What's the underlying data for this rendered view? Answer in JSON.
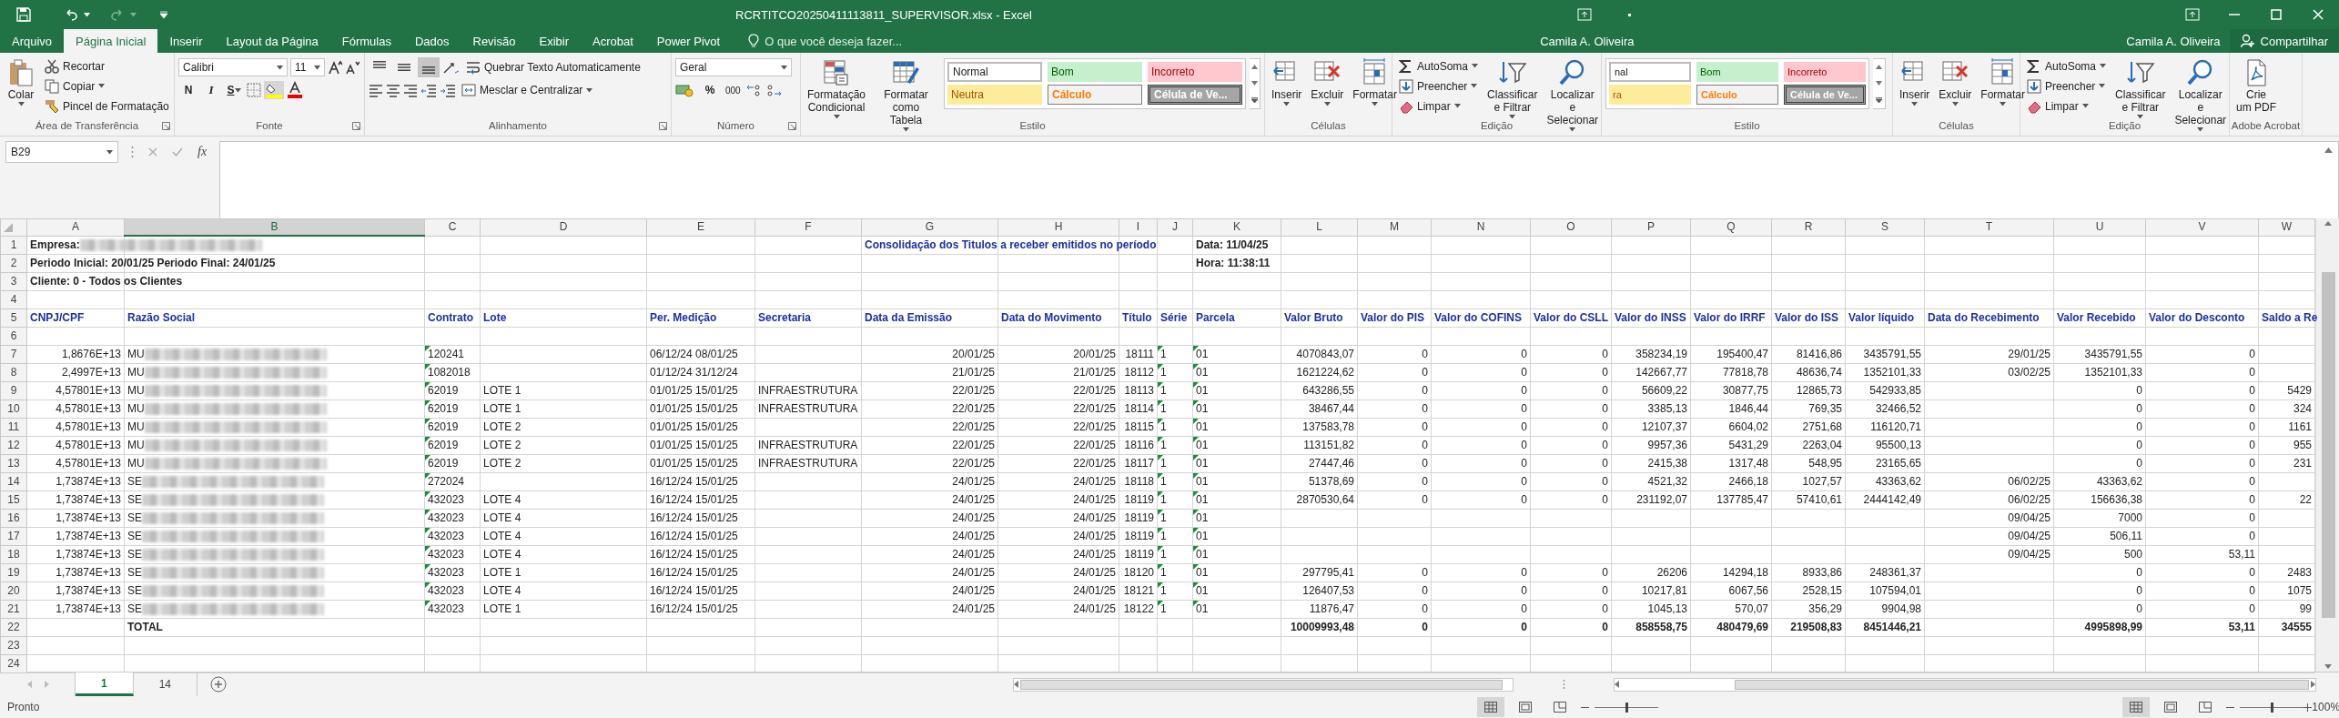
{
  "title_bar": {
    "title": "RCRTITCO20250411113811_SUPERVISOR.xlsx - Excel"
  },
  "ribbon_tabs": {
    "tabs": [
      {
        "label": "Arquivo",
        "selected": false
      },
      {
        "label": "Página Inicial",
        "selected": true
      },
      {
        "label": "Inserir",
        "selected": false
      },
      {
        "label": "Layout da Página",
        "selected": false
      },
      {
        "label": "Fórmulas",
        "selected": false
      },
      {
        "label": "Dados",
        "selected": false
      },
      {
        "label": "Revisão",
        "selected": false
      },
      {
        "label": "Exibir",
        "selected": false
      },
      {
        "label": "Acrobat",
        "selected": false
      },
      {
        "label": "Power Pivot",
        "selected": false
      }
    ],
    "search": {
      "placeholder": "O que você deseja fazer..."
    },
    "users": [
      "Camila A. Oliveira",
      "Camila A. Oliveira"
    ],
    "share": "Compartilhar"
  },
  "ribbon": {
    "groups": [
      {
        "kind": "clipboard",
        "label": "Área de Transferência",
        "items": [
          {
            "kind": "paste",
            "lines": [
              "Colar"
            ]
          },
          {
            "kind": "cut",
            "label": "Recortar"
          },
          {
            "kind": "copy",
            "label": "Copiar"
          },
          {
            "kind": "brush",
            "label": "Pincel de Formatação"
          }
        ]
      },
      {
        "kind": "font",
        "label": "Fonte",
        "items": [
          {
            "kind": "font",
            "label": "Calibri"
          },
          {
            "kind": "size",
            "label": "11"
          },
          {
            "kind": "bold",
            "label": "N"
          },
          {
            "kind": "italic",
            "label": "I"
          },
          {
            "kind": "underline",
            "label": "S"
          }
        ]
      },
      {
        "kind": "alignment",
        "label": "Alinhamento",
        "items": [
          {
            "kind": "align_top",
            "selected": false
          },
          {
            "kind": "align_middle",
            "selected": false
          },
          {
            "kind": "align_bottom",
            "selected": true
          },
          {
            "kind": "wrap",
            "label": "Quebrar Texto Automaticamente"
          },
          {
            "kind": "merge",
            "label": "Mesclar e Centralizar"
          }
        ]
      },
      {
        "kind": "number",
        "label": "Número",
        "items": [
          {
            "kind": "format",
            "label": "Geral"
          },
          {
            "kind": "percent",
            "label": "%"
          },
          {
            "kind": "thousands",
            "label": "000"
          }
        ]
      },
      {
        "kind": "styles",
        "label": "Estilo",
        "buttons": [
          {
            "kind": "condformat",
            "lines": [
              "Formatação",
              "Condicional"
            ]
          },
          {
            "kind": "table",
            "lines": [
              "Formatar como",
              "Tabela"
            ]
          }
        ],
        "items": [
          {
            "kind": "normal",
            "label": "Normal"
          },
          {
            "kind": "good",
            "label": "Bom"
          },
          {
            "kind": "bad",
            "label": "Incorreto"
          },
          {
            "kind": "neutral",
            "label": "Neutra"
          },
          {
            "kind": "calc",
            "label": "Cálculo"
          },
          {
            "kind": "check",
            "label": "Célula de Ve..."
          }
        ]
      },
      {
        "kind": "cells",
        "label": "Células",
        "items": [
          {
            "kind": "insert",
            "lines": [
              "Inserir"
            ]
          },
          {
            "kind": "delete",
            "lines": [
              "Excluir"
            ]
          },
          {
            "kind": "format",
            "lines": [
              "Formatar"
            ]
          }
        ]
      },
      {
        "kind": "editing",
        "label": "Edição",
        "items": [
          {
            "kind": "sum",
            "label": "AutoSoma"
          },
          {
            "kind": "fill",
            "label": "Preencher"
          },
          {
            "kind": "clear",
            "label": "Limpar"
          },
          {
            "kind": "sort",
            "lines": [
              "Classificar",
              "e Filtrar"
            ]
          },
          {
            "kind": "find",
            "lines": [
              "Localizar e",
              "Selecionar"
            ]
          }
        ]
      },
      {
        "kind": "styles",
        "label": "Estilo",
        "items": [
          {
            "kind": "normal",
            "label": "nal"
          },
          {
            "kind": "good",
            "label": "Bom"
          },
          {
            "kind": "bad",
            "label": "Incorreto"
          },
          {
            "kind": "neutral",
            "label": "ra"
          },
          {
            "kind": "calc",
            "label": "Cálculo"
          },
          {
            "kind": "check",
            "label": "Célula de Ve..."
          }
        ]
      },
      {
        "kind": "cells",
        "label": "Células",
        "items": [
          {
            "kind": "insert",
            "lines": [
              "Inserir"
            ]
          },
          {
            "kind": "delete",
            "lines": [
              "Excluir"
            ]
          },
          {
            "kind": "format",
            "lines": [
              "Formatar"
            ]
          }
        ]
      },
      {
        "kind": "editing",
        "label": "Edição",
        "items": [
          {
            "kind": "sum",
            "label": "AutoSoma"
          },
          {
            "kind": "fill",
            "label": "Preencher"
          },
          {
            "kind": "clear",
            "label": "Limpar"
          },
          {
            "kind": "sort",
            "lines": [
              "Classificar",
              "e Filtrar"
            ]
          },
          {
            "kind": "find",
            "lines": [
              "Localizar e",
              "Selecionar"
            ]
          }
        ]
      },
      {
        "kind": "acrobat",
        "label": "Adobe Acrobat",
        "items": [
          {
            "kind": "pdf",
            "lines": [
              "Crie",
              "um PDF"
            ]
          }
        ]
      }
    ]
  },
  "formula_bar": {
    "name_box": "B29",
    "function_label": "fx"
  },
  "sheet": {
    "columns": [
      {
        "letter": "A",
        "selected": false
      },
      {
        "letter": "B",
        "selected": true
      },
      {
        "letter": "C",
        "selected": false
      },
      {
        "letter": "D",
        "selected": false
      },
      {
        "letter": "E",
        "selected": false
      },
      {
        "letter": "F",
        "selected": false
      },
      {
        "letter": "G",
        "selected": false
      },
      {
        "letter": "H",
        "selected": false
      },
      {
        "letter": "I",
        "selected": false
      },
      {
        "letter": "J",
        "selected": false
      },
      {
        "letter": "K",
        "selected": false
      },
      {
        "letter": "L",
        "selected": false
      },
      {
        "letter": "M",
        "selected": false
      },
      {
        "letter": "N",
        "selected": false
      },
      {
        "letter": "O",
        "selected": false
      },
      {
        "letter": "P",
        "selected": false
      },
      {
        "letter": "Q",
        "selected": false
      },
      {
        "letter": "R",
        "selected": false
      },
      {
        "letter": "S",
        "selected": false
      },
      {
        "letter": "T",
        "selected": false
      },
      {
        "letter": "U",
        "selected": false
      },
      {
        "letter": "V",
        "selected": false
      },
      {
        "letter": "W",
        "selected": false
      }
    ],
    "rows": [
      {
        "number": "1",
        "kind": "title",
        "cells": {
          "A": {
            "text": "Empresa:",
            "redacted": true
          },
          "G": {
            "text": "Consolidação dos Titulos a receber emitidos no período",
            "color": "#1f2fa0"
          },
          "K": "Data: 11/04/25"
        }
      },
      {
        "number": "2",
        "kind": "title",
        "cells": {
          "A": "Periodo Inicial: 20/01/25 Periodo Final: 24/01/25",
          "K": "Hora: 11:38:11"
        }
      },
      {
        "number": "3",
        "kind": "title",
        "cells": {
          "A": "Cliente: 0 - Todos os Clientes"
        }
      },
      {
        "number": "4",
        "kind": "blank",
        "cells": {}
      },
      {
        "number": "5",
        "kind": "header",
        "cells": {
          "A": "CNPJ/CPF",
          "B": "Razão Social",
          "C": "Contrato",
          "D": "Lote",
          "E": "Per. Medição",
          "F": "Secretaria",
          "G": "Data da Emissão",
          "H": "Data do Movimento",
          "I": "Título",
          "J": "Série",
          "K": "Parcela",
          "L": "Valor Bruto",
          "M": "Valor do PIS",
          "N": "Valor do COFINS",
          "O": "Valor do CSLL",
          "P": "Valor do INSS",
          "Q": "Valor do IRRF",
          "R": "Valor do ISS",
          "S": "Valor líquido",
          "T": "Data do Recebimento",
          "U": "Valor Recebido",
          "V": "Valor do Desconto",
          "W": "Saldo a Re"
        }
      },
      {
        "number": "6",
        "kind": "blank",
        "cells": {}
      },
      {
        "number": "7",
        "kind": "data",
        "cells": {
          "A": "1,8676E+13",
          "B": {
            "text": "MU",
            "redacted": true
          },
          "C": {
            "text": "120241",
            "flagged": true
          },
          "E": "06/12/24 08/01/25",
          "G": "20/01/25",
          "H": "20/01/25",
          "I": "18111",
          "J": {
            "text": "1",
            "flagged": true
          },
          "K": {
            "text": "01",
            "flagged": true
          },
          "L": "4070843,07",
          "M": "0",
          "N": "0",
          "O": "0",
          "P": "358234,19",
          "Q": "195400,47",
          "R": "81416,86",
          "S": "3435791,55",
          "T": "29/01/25",
          "U": "3435791,55",
          "V": "0"
        }
      },
      {
        "number": "8",
        "kind": "data",
        "cells": {
          "A": "2,4997E+13",
          "B": {
            "text": "MU",
            "redacted": true
          },
          "C": {
            "text": "1082018",
            "flagged": true
          },
          "E": "01/12/24 31/12/24",
          "G": "21/01/25",
          "H": "21/01/25",
          "I": "18112",
          "J": {
            "text": "1",
            "flagged": true
          },
          "K": {
            "text": "01",
            "flagged": true
          },
          "L": "1621224,62",
          "M": "0",
          "N": "0",
          "O": "0",
          "P": "142667,77",
          "Q": "77818,78",
          "R": "48636,74",
          "S": "1352101,33",
          "T": "03/02/25",
          "U": "1352101,33",
          "V": "0"
        }
      },
      {
        "number": "9",
        "kind": "data",
        "cells": {
          "A": "4,57801E+13",
          "B": {
            "text": "MU",
            "redacted": true
          },
          "C": {
            "text": "62019",
            "flagged": true
          },
          "D": "LOTE 1",
          "E": "01/01/25 15/01/25",
          "F": "INFRAESTRUTURA",
          "G": "22/01/25",
          "H": "22/01/25",
          "I": "18113",
          "J": {
            "text": "1",
            "flagged": true
          },
          "K": {
            "text": "01",
            "flagged": true
          },
          "L": "643286,55",
          "M": "0",
          "N": "0",
          "O": "0",
          "P": "56609,22",
          "Q": "30877,75",
          "R": "12865,73",
          "S": "542933,85",
          "U": "0",
          "V": "0",
          "W": "5429"
        }
      },
      {
        "number": "10",
        "kind": "data",
        "cells": {
          "A": "4,57801E+13",
          "B": {
            "text": "MU",
            "redacted": true
          },
          "C": {
            "text": "62019",
            "flagged": true
          },
          "D": "LOTE 1",
          "E": "01/01/25 15/01/25",
          "F": "INFRAESTRUTURA",
          "G": "22/01/25",
          "H": "22/01/25",
          "I": "18114",
          "J": {
            "text": "1",
            "flagged": true
          },
          "K": {
            "text": "01",
            "flagged": true
          },
          "L": "38467,44",
          "M": "0",
          "N": "0",
          "O": "0",
          "P": "3385,13",
          "Q": "1846,44",
          "R": "769,35",
          "S": "32466,52",
          "U": "0",
          "V": "0",
          "W": "324"
        }
      },
      {
        "number": "11",
        "kind": "data",
        "cells": {
          "A": "4,57801E+13",
          "B": {
            "text": "MU",
            "redacted": true
          },
          "C": {
            "text": "62019",
            "flagged": true
          },
          "D": "LOTE 2",
          "E": "01/01/25 15/01/25",
          "G": "22/01/25",
          "H": "22/01/25",
          "I": "18115",
          "J": {
            "text": "1",
            "flagged": true
          },
          "K": {
            "text": "01",
            "flagged": true
          },
          "L": "137583,78",
          "M": "0",
          "N": "0",
          "O": "0",
          "P": "12107,37",
          "Q": "6604,02",
          "R": "2751,68",
          "S": "116120,71",
          "U": "0",
          "V": "0",
          "W": "1161"
        }
      },
      {
        "number": "12",
        "kind": "data",
        "cells": {
          "A": "4,57801E+13",
          "B": {
            "text": "MU",
            "redacted": true
          },
          "C": {
            "text": "62019",
            "flagged": true
          },
          "D": "LOTE 2",
          "E": "01/01/25 15/01/25",
          "F": "INFRAESTRUTURA",
          "G": "22/01/25",
          "H": "22/01/25",
          "I": "18116",
          "J": {
            "text": "1",
            "flagged": true
          },
          "K": {
            "text": "01",
            "flagged": true
          },
          "L": "113151,82",
          "M": "0",
          "N": "0",
          "O": "0",
          "P": "9957,36",
          "Q": "5431,29",
          "R": "2263,04",
          "S": "95500,13",
          "U": "0",
          "V": "0",
          "W": "955"
        }
      },
      {
        "number": "13",
        "kind": "data",
        "cells": {
          "A": "4,57801E+13",
          "B": {
            "text": "MU",
            "redacted": true
          },
          "C": {
            "text": "62019",
            "flagged": true
          },
          "D": "LOTE 2",
          "E": "01/01/25 15/01/25",
          "F": "INFRAESTRUTURA",
          "G": "22/01/25",
          "H": "22/01/25",
          "I": "18117",
          "J": {
            "text": "1",
            "flagged": true
          },
          "K": {
            "text": "01",
            "flagged": true
          },
          "L": "27447,46",
          "M": "0",
          "N": "0",
          "O": "0",
          "P": "2415,38",
          "Q": "1317,48",
          "R": "548,95",
          "S": "23165,65",
          "U": "0",
          "V": "0",
          "W": "231"
        }
      },
      {
        "number": "14",
        "kind": "data",
        "cells": {
          "A": "1,73874E+13",
          "B": {
            "text": "SE",
            "redacted": true
          },
          "C": {
            "text": "272024",
            "flagged": true
          },
          "E": "16/12/24 15/01/25",
          "G": "24/01/25",
          "H": "24/01/25",
          "I": "18118",
          "J": {
            "text": "1",
            "flagged": true
          },
          "K": {
            "text": "01",
            "flagged": true
          },
          "L": "51378,69",
          "M": "0",
          "N": "0",
          "O": "0",
          "P": "4521,32",
          "Q": "2466,18",
          "R": "1027,57",
          "S": "43363,62",
          "T": "06/02/25",
          "U": "43363,62",
          "V": "0"
        }
      },
      {
        "number": "15",
        "kind": "data",
        "cells": {
          "A": "1,73874E+13",
          "B": {
            "text": "SE",
            "redacted": true
          },
          "C": {
            "text": "432023",
            "flagged": true
          },
          "D": "LOTE 4",
          "E": "16/12/24 15/01/25",
          "G": "24/01/25",
          "H": "24/01/25",
          "I": "18119",
          "J": {
            "text": "1",
            "flagged": true
          },
          "K": {
            "text": "01",
            "flagged": true
          },
          "L": "2870530,64",
          "M": "0",
          "N": "0",
          "O": "0",
          "P": "231192,07",
          "Q": "137785,47",
          "R": "57410,61",
          "S": "2444142,49",
          "T": "06/02/25",
          "U": "156636,38",
          "V": "0",
          "W": "22"
        }
      },
      {
        "number": "16",
        "kind": "data",
        "cells": {
          "A": "1,73874E+13",
          "B": {
            "text": "SE",
            "redacted": true
          },
          "C": {
            "text": "432023",
            "flagged": true
          },
          "D": "LOTE 4",
          "E": "16/12/24 15/01/25",
          "G": "24/01/25",
          "H": "24/01/25",
          "I": "18119",
          "J": {
            "text": "1",
            "flagged": true
          },
          "K": {
            "text": "01",
            "flagged": true
          },
          "T": "09/04/25",
          "U": "7000",
          "V": "0"
        }
      },
      {
        "number": "17",
        "kind": "data",
        "cells": {
          "A": "1,73874E+13",
          "B": {
            "text": "SE",
            "redacted": true
          },
          "C": {
            "text": "432023",
            "flagged": true
          },
          "D": "LOTE 4",
          "E": "16/12/24 15/01/25",
          "G": "24/01/25",
          "H": "24/01/25",
          "I": "18119",
          "J": {
            "text": "1",
            "flagged": true
          },
          "K": {
            "text": "01",
            "flagged": true
          },
          "T": "09/04/25",
          "U": "506,11",
          "V": "0"
        }
      },
      {
        "number": "18",
        "kind": "data",
        "cells": {
          "A": "1,73874E+13",
          "B": {
            "text": "SE",
            "redacted": true
          },
          "C": {
            "text": "432023",
            "flagged": true
          },
          "D": "LOTE 4",
          "E": "16/12/24 15/01/25",
          "G": "24/01/25",
          "H": "24/01/25",
          "I": "18119",
          "J": {
            "text": "1",
            "flagged": true
          },
          "K": {
            "text": "01",
            "flagged": true
          },
          "T": "09/04/25",
          "U": "500",
          "V": "53,11"
        }
      },
      {
        "number": "19",
        "kind": "data",
        "cells": {
          "A": "1,73874E+13",
          "B": {
            "text": "SE",
            "redacted": true
          },
          "C": {
            "text": "432023",
            "flagged": true
          },
          "D": "LOTE 1",
          "E": "16/12/24 15/01/25",
          "G": "24/01/25",
          "H": "24/01/25",
          "I": "18120",
          "J": {
            "text": "1",
            "flagged": true
          },
          "K": {
            "text": "01",
            "flagged": true
          },
          "L": "297795,41",
          "M": "0",
          "N": "0",
          "O": "0",
          "P": "26206",
          "Q": "14294,18",
          "R": "8933,86",
          "S": "248361,37",
          "U": "0",
          "V": "0",
          "W": "2483"
        }
      },
      {
        "number": "20",
        "kind": "data",
        "cells": {
          "A": "1,73874E+13",
          "B": {
            "text": "SE",
            "redacted": true
          },
          "C": {
            "text": "432023",
            "flagged": true
          },
          "D": "LOTE 4",
          "E": "16/12/24 15/01/25",
          "G": "24/01/25",
          "H": "24/01/25",
          "I": "18121",
          "J": {
            "text": "1",
            "flagged": true
          },
          "K": {
            "text": "01",
            "flagged": true
          },
          "L": "126407,53",
          "M": "0",
          "N": "0",
          "O": "0",
          "P": "10217,81",
          "Q": "6067,56",
          "R": "2528,15",
          "S": "107594,01",
          "U": "0",
          "V": "0",
          "W": "1075"
        }
      },
      {
        "number": "21",
        "kind": "data",
        "cells": {
          "A": "1,73874E+13",
          "B": {
            "text": "SE",
            "redacted": true
          },
          "C": {
            "text": "432023",
            "flagged": true
          },
          "D": "LOTE 1",
          "E": "16/12/24 15/01/25",
          "G": "24/01/25",
          "H": "24/01/25",
          "I": "18122",
          "J": {
            "text": "1",
            "flagged": true
          },
          "K": {
            "text": "01",
            "flagged": true
          },
          "L": "11876,47",
          "M": "0",
          "N": "0",
          "O": "0",
          "P": "1045,13",
          "Q": "570,07",
          "R": "356,29",
          "S": "9904,98",
          "U": "0",
          "V": "0",
          "W": "99"
        }
      },
      {
        "number": "22",
        "kind": "total",
        "cells": {
          "B": "TOTAL",
          "L": "10009993,48",
          "M": "0",
          "N": "0",
          "O": "0",
          "P": "858558,75",
          "Q": "480479,69",
          "R": "219508,83",
          "S": "8451446,21",
          "U": "4995898,99",
          "V": "53,11",
          "W": "34555"
        }
      },
      {
        "number": "23",
        "kind": "blank",
        "cells": {}
      },
      {
        "number": "24",
        "kind": "blank",
        "cells": {}
      }
    ]
  },
  "sheet_tabs": {
    "tabs": [
      {
        "label": "1",
        "selected": true
      },
      {
        "label": "14",
        "selected": false
      }
    ]
  },
  "status_bar": {
    "status": "Pronto",
    "sliders": [
      {
        "level": 0.5
      },
      {
        "level": 0.5
      }
    ],
    "zoom": "100%"
  }
}
